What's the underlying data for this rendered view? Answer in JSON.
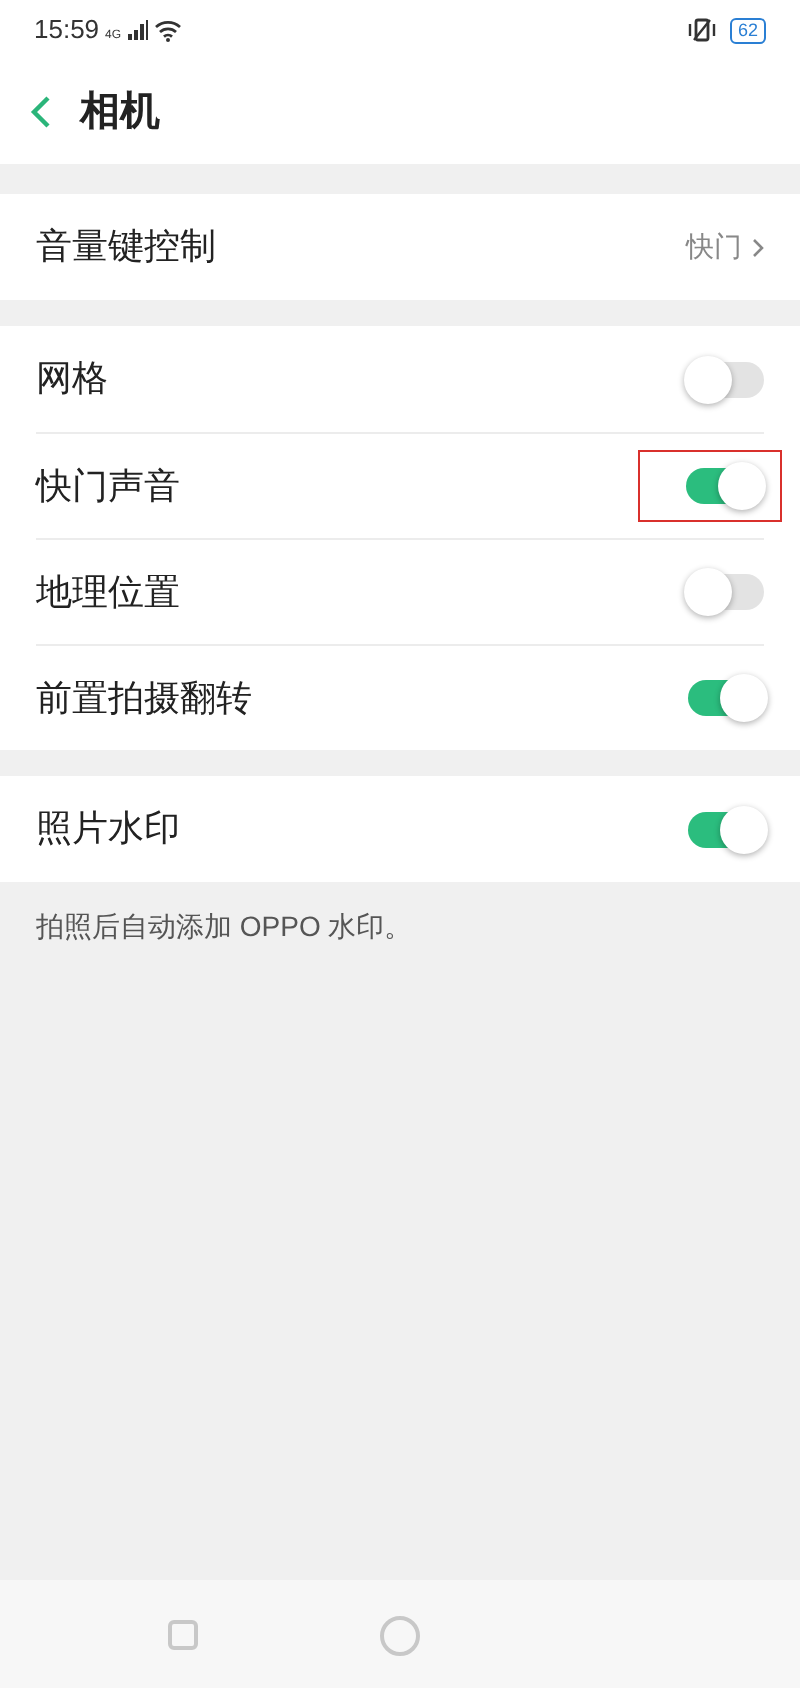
{
  "status_bar": {
    "time": "15:59",
    "signal_label": "4G",
    "battery": "62"
  },
  "header": {
    "title": "相机"
  },
  "sections": [
    {
      "rows": [
        {
          "kind": "link",
          "label": "音量键控制",
          "value": "快门"
        }
      ]
    },
    {
      "rows": [
        {
          "kind": "toggle",
          "label": "网格",
          "on": false,
          "highlighted": false
        },
        {
          "kind": "toggle",
          "label": "快门声音",
          "on": true,
          "highlighted": true
        },
        {
          "kind": "toggle",
          "label": "地理位置",
          "on": false,
          "highlighted": false
        },
        {
          "kind": "toggle",
          "label": "前置拍摄翻转",
          "on": true,
          "highlighted": false
        }
      ]
    },
    {
      "rows": [
        {
          "kind": "toggle",
          "label": "照片水印",
          "on": true,
          "highlighted": false
        }
      ],
      "note": "拍照后自动添加 OPPO 水印。"
    }
  ]
}
